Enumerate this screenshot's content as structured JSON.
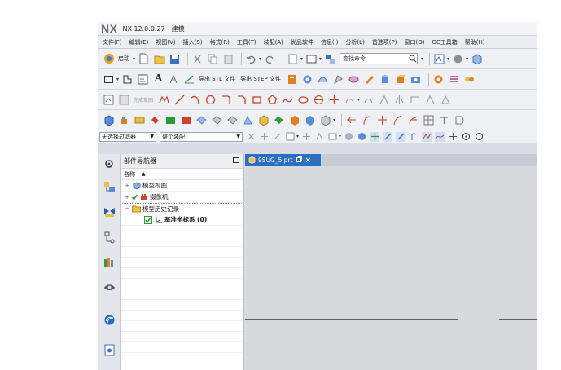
{
  "app": {
    "logo": "NX",
    "title": "NX 12.0.0.27 - 建模"
  },
  "menu": [
    "文件(F)",
    "编辑(E)",
    "视图(V)",
    "插入(S)",
    "格式(R)",
    "工具(T)",
    "装配(A)",
    "优品软件",
    "信息(I)",
    "分析(L)",
    "首选项(P)",
    "窗口(O)",
    "GC工具箱",
    "帮助(H)"
  ],
  "toolbar1": {
    "start_label": "启动",
    "search_placeholder": "查找命令"
  },
  "toolbar2": {
    "export_stl": "导出 STL 文件",
    "export_step": "导出 STEP 文件"
  },
  "filterbar": {
    "selection_filter": "无选择过滤器",
    "assembly_scope": "整个装配"
  },
  "navigator": {
    "title": "部件导航器",
    "column_name": "名称",
    "items": [
      {
        "label": "模型视图",
        "expander": "+"
      },
      {
        "label": "摄像机",
        "expander": "+"
      },
      {
        "label": "模型历史记录",
        "expander": "−"
      },
      {
        "label": "基准坐标系 (0)",
        "expander": ""
      }
    ]
  },
  "document_tab": {
    "label": "9SUG_5.prt",
    "close_glyph": "×"
  },
  "colors": {
    "tab_active": "#2c6ec0",
    "viewport_bg": "#d7dadd",
    "check_green": "#2e9a3a"
  }
}
